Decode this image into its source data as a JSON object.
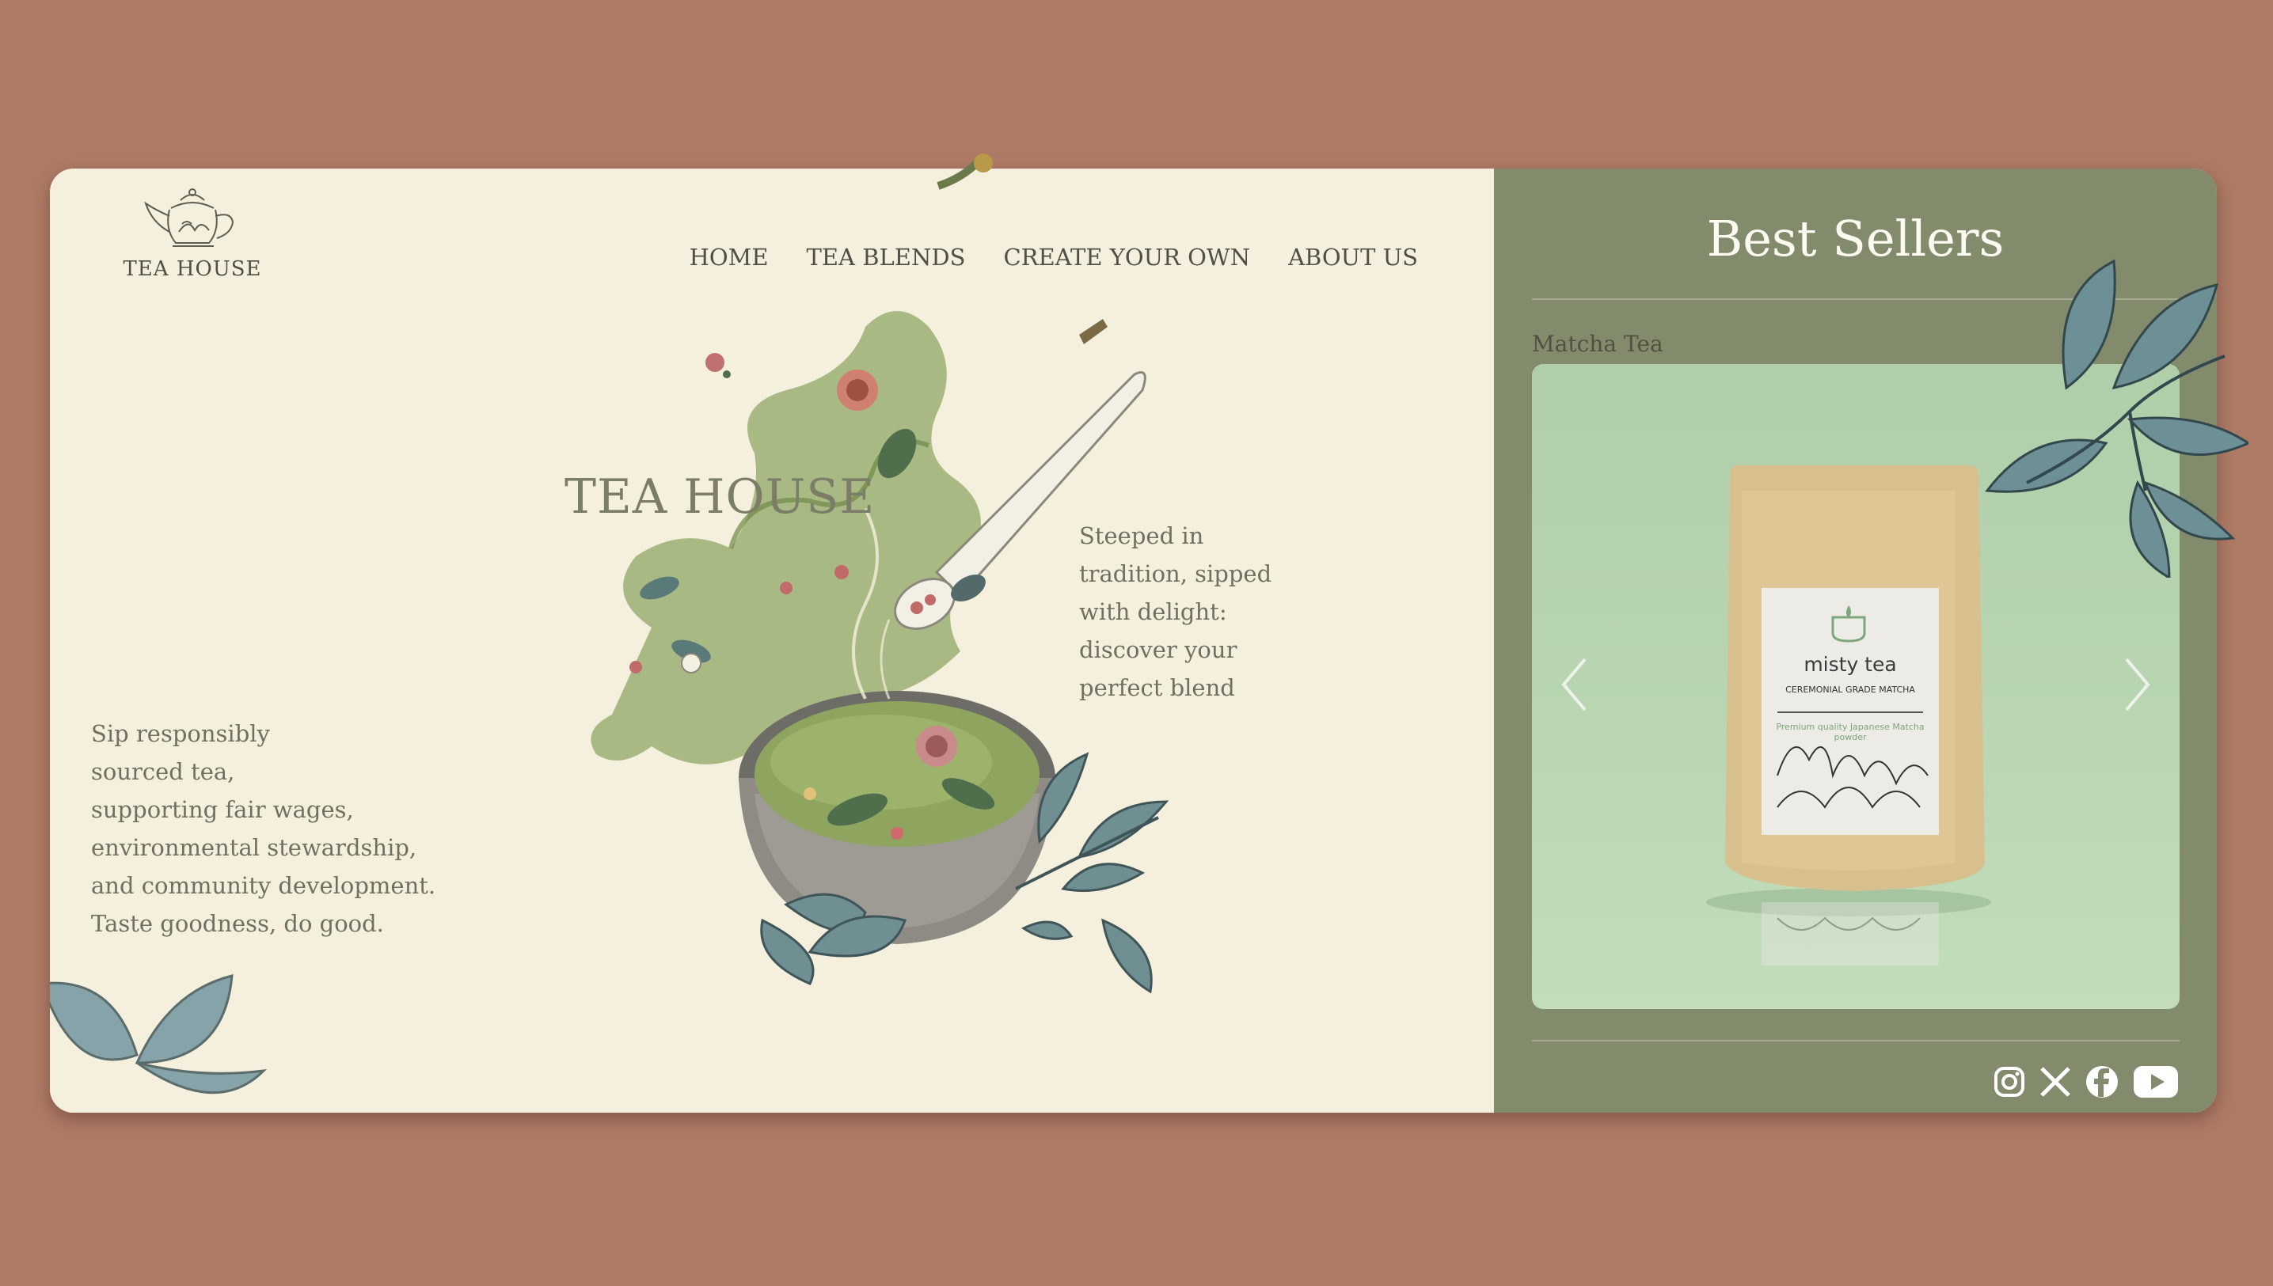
{
  "brand": {
    "logo_text": "TEA HOUSE"
  },
  "nav": {
    "items": [
      {
        "label": "HOME"
      },
      {
        "label": "TEA BLENDS"
      },
      {
        "label": "CREATE YOUR OWN"
      },
      {
        "label": "ABOUT US"
      }
    ]
  },
  "hero": {
    "title": "TEA HOUSE",
    "tagline": "Steeped in tradition, sipped with delight: discover your perfect blend",
    "tagline_lines": [
      "Steeped in",
      "tradition, sipped",
      "with delight:",
      "discover your",
      "perfect blend"
    ],
    "mission_lines": [
      "Sip responsibly",
      "sourced tea,",
      "supporting fair wages,",
      "environmental stewardship,",
      "and community development.",
      "Taste goodness, do good."
    ]
  },
  "best_sellers": {
    "title": "Best Sellers",
    "current_product": {
      "name": "Matcha Tea",
      "package_brand": "misty tea",
      "package_subtitle": "CEREMONIAL GRADE MATCHA",
      "package_note": "Premium quality Japanese Matcha powder"
    }
  },
  "social": {
    "icons": [
      "instagram-icon",
      "x-icon",
      "facebook-icon",
      "youtube-icon"
    ]
  },
  "colors": {
    "background": "#ad7a65",
    "card_left": "#f5f0dd",
    "card_right": "#838b6d",
    "text": "#4f4f45",
    "hero_title": "#7b7d69",
    "carousel_bg": "#b8d4b0"
  }
}
